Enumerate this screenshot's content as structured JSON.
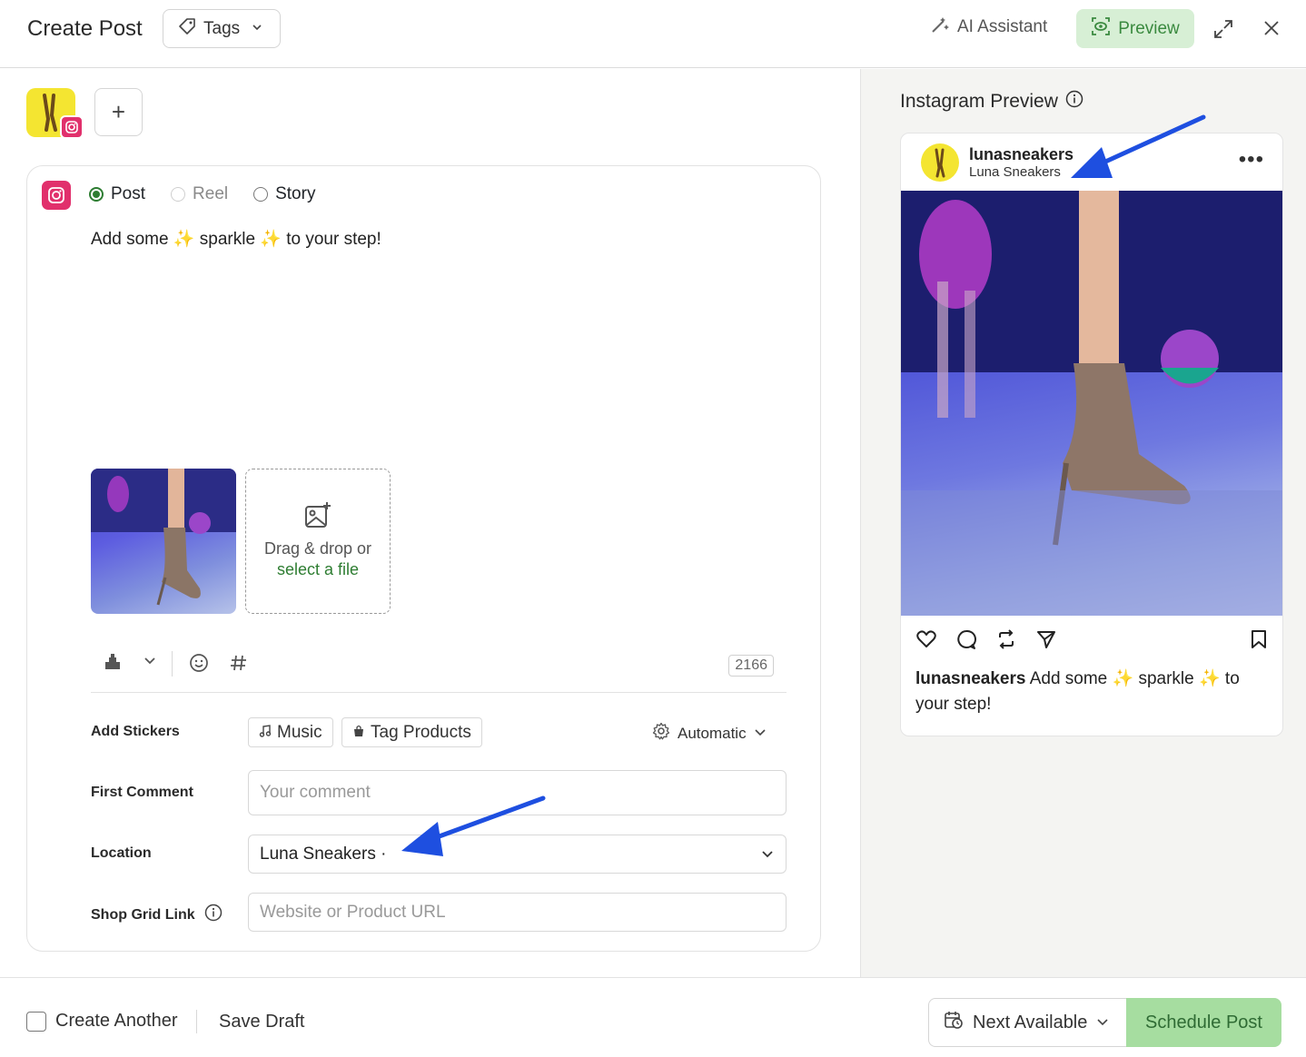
{
  "header": {
    "title": "Create Post",
    "tags_label": "Tags",
    "ai_assistant_label": "AI Assistant",
    "preview_label": "Preview"
  },
  "composer": {
    "post_types": [
      {
        "label": "Post",
        "selected": true,
        "disabled": false
      },
      {
        "label": "Reel",
        "selected": false,
        "disabled": true
      },
      {
        "label": "Story",
        "selected": false,
        "disabled": false
      }
    ],
    "caption": "Add some ✨ sparkle ✨ to your step!",
    "dropzone_line1": "Drag & drop or",
    "dropzone_line2": "select a file",
    "char_counter": "2166",
    "add_stickers_label": "Add Stickers",
    "music_label": "Music",
    "tag_products_label": "Tag Products",
    "automatic_label": "Automatic",
    "first_comment_label": "First Comment",
    "first_comment_placeholder": "Your comment",
    "location_label": "Location",
    "location_value": "Luna Sneakers ·",
    "shop_grid_label": "Shop Grid Link",
    "shop_grid_placeholder": "Website or Product URL"
  },
  "preview": {
    "title": "Instagram Preview",
    "username": "lunasneakers",
    "display_name": "Luna Sneakers",
    "caption_user": "lunasneakers",
    "caption_text": "Add some ✨ sparkle ✨ to your step!"
  },
  "footer": {
    "create_another_label": "Create Another",
    "save_draft_label": "Save Draft",
    "next_available_label": "Next Available",
    "schedule_label": "Schedule Post"
  },
  "colors": {
    "accent_green": "#2e7d32",
    "preview_bg": "#d7efd5",
    "schedule_bg": "#a6dda0",
    "instagram_pink": "#e1306c",
    "avatar_yellow": "#f4e531",
    "arrow_blue": "#1e4fe0"
  }
}
